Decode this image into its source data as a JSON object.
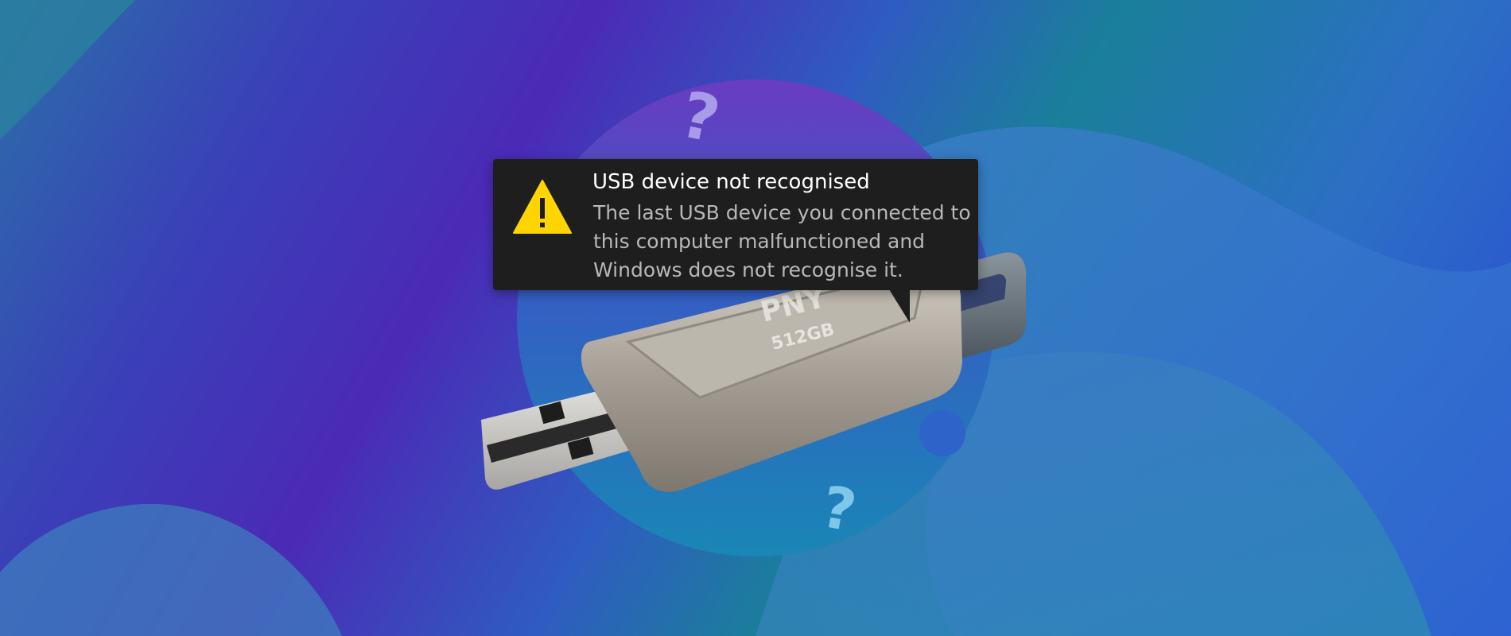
{
  "notification": {
    "title": "USB device not recognised",
    "message_lines": [
      "The last USB device you connected to",
      "this computer malfunctioned and",
      "Windows does not recognise it."
    ],
    "icon": "warning-triangle-icon",
    "icon_color": "#ffd400"
  },
  "device": {
    "brand": "PNY",
    "capacity": "512GB"
  },
  "decorations": {
    "question_mark": "?"
  },
  "colors": {
    "toast_background": "#1e1e1e",
    "title_text": "#ffffff",
    "body_text": "#b8b8b8"
  }
}
